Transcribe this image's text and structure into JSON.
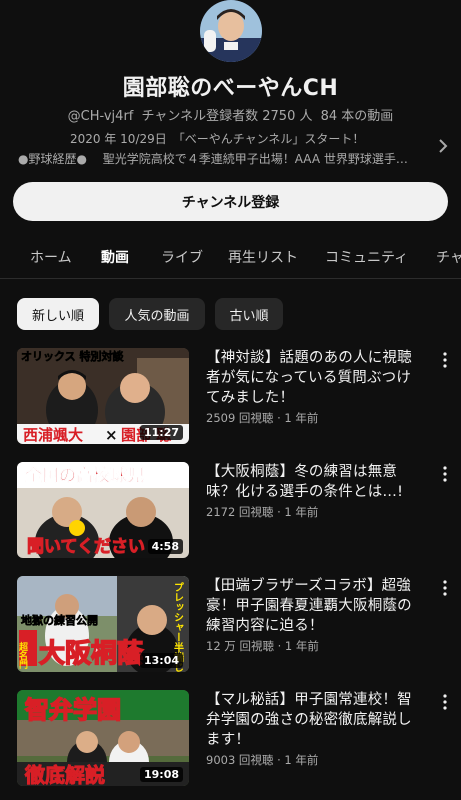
{
  "channel": {
    "name": "園部聡のべーやんCH",
    "handle": "@CH-vj4rf",
    "subscribers": "チャンネル登録者数 2750 人",
    "video_count": "84 本の動画",
    "description_line1": "2020 年 10/29日　「べーやんチャンネル」スタート！",
    "description_line2": "●野球経歴●　 聖光学院高校で４季連続甲子出場！AAA 世界野球選手…",
    "subscribe_label": "チャンネル登録"
  },
  "tabs": [
    {
      "label": "ホーム"
    },
    {
      "label": "動画"
    },
    {
      "label": "ライブ"
    },
    {
      "label": "再生リスト"
    },
    {
      "label": "コミュニティ"
    },
    {
      "label": "チャ"
    }
  ],
  "chips": [
    {
      "label": "新しい順"
    },
    {
      "label": "人気の動画"
    },
    {
      "label": "古い順"
    }
  ],
  "videos": [
    {
      "title": "【神対談】話題のあの人に視聴者が気になっている質問ぶつけてみました！",
      "views": "2509 回視聴",
      "age": "1 年前",
      "duration": "11:27",
      "thumb_text_top": "オリックス 特別対談",
      "thumb_text_bottom_left": "西浦颯大",
      "thumb_text_x": "×",
      "thumb_text_bottom_right": "園部 聡"
    },
    {
      "title": "【大阪桐蔭】冬の練習は無意味？化ける選手の条件とは…!",
      "views": "2172 回視聴",
      "age": "1 年前",
      "duration": "4:58",
      "thumb_text_top": "全国の高校球児",
      "thumb_text_bottom": "聞いてください"
    },
    {
      "title": "【田端ブラザーズコラボ】超強豪！甲子園春夏連覇大阪桐蔭の練習内容に迫る！",
      "views": "12 万 回視聴",
      "age": "1 年前",
      "duration": "13:04",
      "thumb_text_top": "地獄の練習公開",
      "thumb_text_side": "超名門",
      "thumb_text_main": "大阪桐蔭",
      "thumb_text_vertical": "プレッシャー半端じゃ"
    },
    {
      "title": "【マル秘話】甲子園常連校！智弁学園の強さの秘密徹底解説します！",
      "views": "9003 回視聴",
      "age": "1 年前",
      "duration": "19:08",
      "thumb_text_top": "智弁学園",
      "thumb_text_bottom": "徹底解説"
    }
  ],
  "colors": {
    "background": "#0f0f0f",
    "text": "#f1f1f1",
    "secondary": "#aaaaaa",
    "chip_bg": "#272727",
    "accent_red": "#d81f26",
    "accent_yellow": "#ffe600"
  },
  "icons": [
    "chevron-right-icon",
    "more-vert-icon"
  ]
}
